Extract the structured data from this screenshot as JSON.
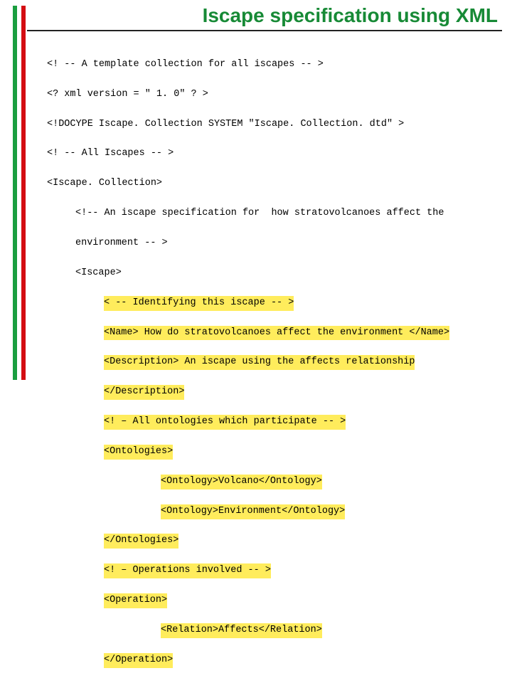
{
  "title": "Iscape specification using XML",
  "code": {
    "l1": "<! -- A template collection for all iscapes -- >",
    "l2": "<? xml version = \" 1. 0\" ? >",
    "l3": "<!DOCYPE Iscape. Collection SYSTEM \"Iscape. Collection. dtd\" >",
    "l4": "<! -- All Iscapes -- >",
    "l5": "<Iscape. Collection>",
    "l6": "<!-- An iscape specification for  how stratovolcanoes affect the",
    "l7": "environment -- >",
    "l8": "<Iscape>",
    "l9": "< -- Identifying this iscape -- >",
    "l10": "<Name> How do stratovolcanoes affect the environment </Name>",
    "l11": "<Description> An iscape using the affects relationship",
    "l12": "</Description>",
    "l13": "<! – All ontologies which participate -- >",
    "l14": "<Ontologies>",
    "l15": "<Ontology>Volcano</Ontology>",
    "l16": "<Ontology>Environment</Ontology>",
    "l17": "</Ontologies>",
    "l18": "<! – Operations involved -- >",
    "l19": "<Operation>",
    "l20": "<Relation>Affects</Relation>",
    "l21": "</Operation>"
  }
}
